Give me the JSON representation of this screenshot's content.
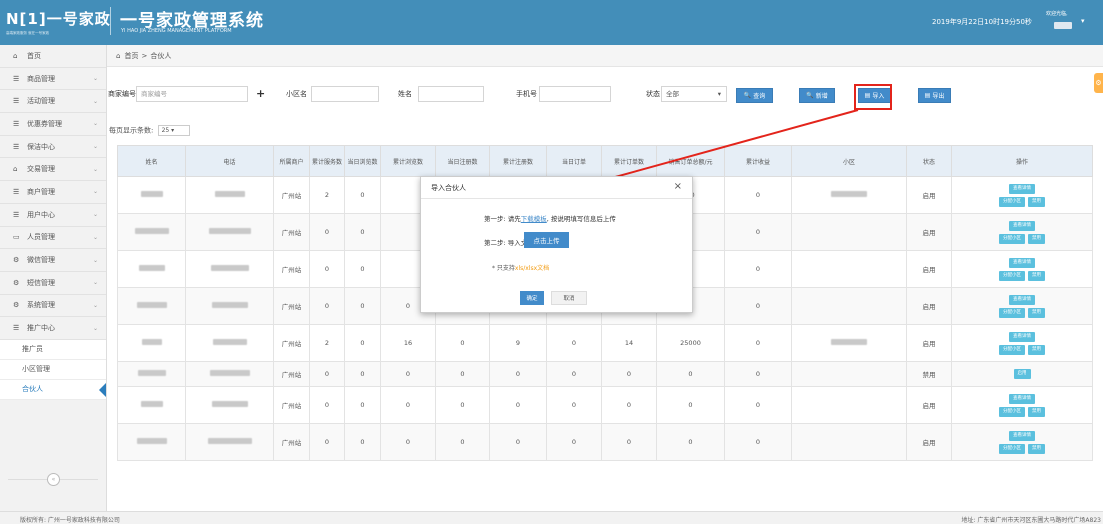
{
  "header": {
    "logo_text": "N[1]一号家政",
    "logo_tagline": "高端家政服务 就在一号家政",
    "title": "一号家政管理系统",
    "subtitle": "YI HAO JIA ZHENG MANAGEMENT PLATFORM",
    "datetime": "2019年9月22日10时19分50秒",
    "user_label": "欢迎光临,"
  },
  "sidebar": {
    "items": [
      {
        "label": "首页",
        "icon": "home-icon"
      },
      {
        "label": "商品管理",
        "icon": "list-icon"
      },
      {
        "label": "活动管理",
        "icon": "list-icon"
      },
      {
        "label": "优惠券管理",
        "icon": "list-icon"
      },
      {
        "label": "保洁中心",
        "icon": "list-icon"
      },
      {
        "label": "交易管理",
        "icon": "home-icon"
      },
      {
        "label": "商户管理",
        "icon": "list-icon"
      },
      {
        "label": "用户中心",
        "icon": "list-icon"
      },
      {
        "label": "人员管理",
        "icon": "monitor-icon"
      },
      {
        "label": "微信管理",
        "icon": "cogs-icon"
      },
      {
        "label": "短信管理",
        "icon": "cogs-icon"
      },
      {
        "label": "系统管理",
        "icon": "cogs-icon"
      },
      {
        "label": "推广中心",
        "icon": "list-icon"
      }
    ],
    "sub_items": [
      "推广员",
      "小区管理",
      "合伙人"
    ],
    "collapse_glyph": "«"
  },
  "breadcrumb": {
    "home": "首页",
    "sep": ">",
    "current": "合伙人"
  },
  "filters": {
    "merchant_no_label": "商家编号",
    "merchant_no_placeholder": "商家编号",
    "community_label": "小区名",
    "name_label": "姓名",
    "phone_label": "手机号",
    "status_label": "状态",
    "status_value": "全部",
    "search_btn": "查询",
    "add_btn": "新增",
    "import_btn": "导入",
    "export_btn": "导出"
  },
  "page_size": {
    "label": "每页显示条数:",
    "value": "25"
  },
  "table": {
    "headers": [
      "姓名",
      "电话",
      "所属商户",
      "累计服务数",
      "当日浏览数",
      "累计浏览数",
      "当日注册数",
      "累计注册数",
      "当日订单",
      "累计订单数",
      "销售订单总额/元",
      "累计收益",
      "小区",
      "状态",
      "操作"
    ],
    "rows": [
      {
        "merchant": "广州站",
        "served": "2",
        "day_view": "0",
        "total_view": "",
        "day_reg": "",
        "total_reg": "",
        "day_order": "",
        "total_order": "",
        "sales": "10",
        "income": "0",
        "status": "启用",
        "highlight_view": false
      },
      {
        "merchant": "广州站",
        "served": "0",
        "day_view": "0",
        "total_view": "",
        "day_reg": "",
        "total_reg": "",
        "day_order": "",
        "total_order": "",
        "sales": "0",
        "income": "0",
        "status": "启用",
        "highlight_view": false
      },
      {
        "merchant": "广州站",
        "served": "0",
        "day_view": "0",
        "total_view": "",
        "day_reg": "",
        "total_reg": "",
        "day_order": "",
        "total_order": "",
        "sales": "0",
        "income": "0",
        "status": "启用",
        "highlight_view": false
      },
      {
        "merchant": "广州站",
        "served": "0",
        "day_view": "0",
        "total_view": "0",
        "day_reg": "0",
        "total_reg": "0",
        "day_order": "0",
        "total_order": "0",
        "sales": "0",
        "income": "0",
        "status": "启用",
        "highlight_view": false
      },
      {
        "merchant": "广州站",
        "served": "2",
        "day_view": "0",
        "total_view": "16",
        "day_reg": "0",
        "total_reg": "9",
        "day_order": "0",
        "total_order": "14",
        "sales": "25000",
        "income": "0",
        "status": "启用",
        "highlight_view": true
      },
      {
        "merchant": "广州站",
        "served": "0",
        "day_view": "0",
        "total_view": "0",
        "day_reg": "0",
        "total_reg": "0",
        "day_order": "0",
        "total_order": "0",
        "sales": "0",
        "income": "0",
        "status": "禁用",
        "highlight_view": false
      },
      {
        "merchant": "广州站",
        "served": "0",
        "day_view": "0",
        "total_view": "0",
        "day_reg": "0",
        "total_reg": "0",
        "day_order": "0",
        "total_order": "0",
        "sales": "0",
        "income": "0",
        "status": "启用",
        "highlight_view": false
      },
      {
        "merchant": "广州站",
        "served": "0",
        "day_view": "0",
        "total_view": "0",
        "day_reg": "0",
        "total_reg": "0",
        "day_order": "0",
        "total_order": "0",
        "sales": "0",
        "income": "0",
        "status": "启用",
        "highlight_view": false
      }
    ],
    "op_labels": {
      "detail": "查看详情",
      "assign": "分配小区",
      "disable": "禁用",
      "enable": "启用"
    }
  },
  "modal": {
    "title": "导入合伙人",
    "close": "×",
    "step1_prefix": "第一步: 请先",
    "step1_link": "下载模板",
    "step1_suffix": ", 按说明填写信息后上传",
    "step2_label": "第二步: 导入文件",
    "upload_btn": "点击上传",
    "note_prefix": "* 只支持",
    "note_ext": "xls/xlsx文档",
    "ok_btn": "确定",
    "cancel_btn": "取消"
  },
  "footer": {
    "copyright": "版权所有: 广州一号家政科技有限公司",
    "address": "地址: 广东省广州市天河区东圃大马路时代广场A823"
  },
  "colors": {
    "topbar": "#438eb9",
    "button": "#428bca",
    "highlight": "#e3241b",
    "arrow": "#e3241b"
  }
}
